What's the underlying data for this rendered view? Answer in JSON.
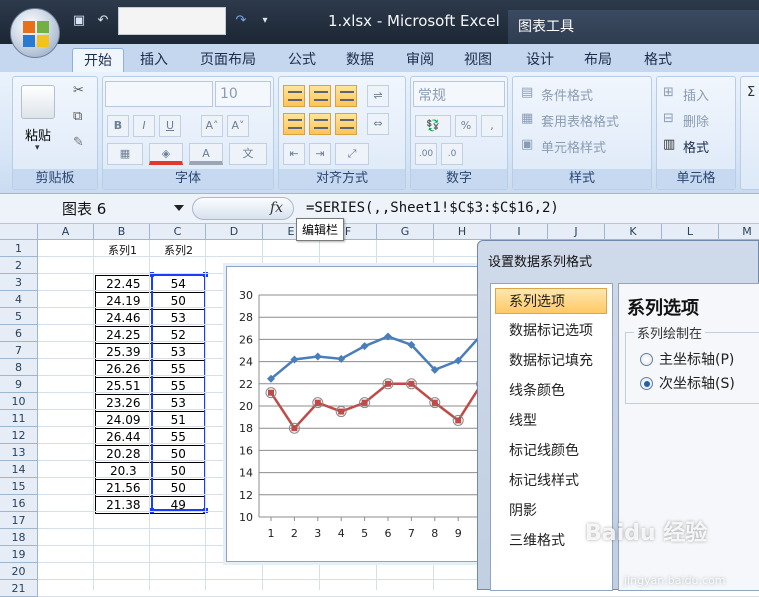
{
  "window": {
    "title": "1.xlsx - Microsoft Excel",
    "context_tab": "图表工具"
  },
  "ribbon": {
    "tabs": [
      "开始",
      "插入",
      "页面布局",
      "公式",
      "数据",
      "审阅",
      "视图",
      "设计",
      "布局",
      "格式"
    ],
    "active_tab": "开始",
    "groups": {
      "clipboard": {
        "label": "剪贴板",
        "paste": "粘贴"
      },
      "font": {
        "label": "字体",
        "size": "10",
        "bold": "B",
        "italic": "I",
        "underline": "U"
      },
      "alignment": {
        "label": "对齐方式"
      },
      "number": {
        "label": "数字",
        "format": "常规",
        "percent": "%",
        "comma": ",",
        "inc_dec": ".00",
        "dec_dec": ".0"
      },
      "styles": {
        "label": "样式",
        "conditional": "条件格式",
        "table": "套用表格格式",
        "cell_styles": "单元格样式"
      },
      "cells": {
        "label": "单元格",
        "insert": "插入",
        "delete": "删除",
        "format": "格式"
      }
    }
  },
  "formula_bar": {
    "name_box": "图表 6",
    "fx": "fx",
    "formula": "=SERIES(,,Sheet1!$C$3:$C$16,2)",
    "tooltip": "编辑栏"
  },
  "sheet": {
    "columns": [
      "A",
      "B",
      "C",
      "D",
      "E",
      "F",
      "G",
      "H",
      "I",
      "J",
      "K",
      "L",
      "M"
    ],
    "rows": [
      "1",
      "2",
      "3",
      "4",
      "5",
      "6",
      "7",
      "8",
      "9",
      "10",
      "11",
      "12",
      "13",
      "14",
      "15",
      "16",
      "17",
      "18",
      "19",
      "20",
      "21"
    ],
    "headers": {
      "b1": "系列1",
      "c1": "系列2"
    },
    "table": [
      [
        "22.45",
        "54"
      ],
      [
        "24.19",
        "50"
      ],
      [
        "24.46",
        "53"
      ],
      [
        "24.25",
        "52"
      ],
      [
        "25.39",
        "53"
      ],
      [
        "26.26",
        "55"
      ],
      [
        "25.51",
        "55"
      ],
      [
        "23.26",
        "53"
      ],
      [
        "24.09",
        "51"
      ],
      [
        "26.44",
        "55"
      ],
      [
        "20.28",
        "50"
      ],
      [
        "20.3",
        "50"
      ],
      [
        "21.56",
        "50"
      ],
      [
        "21.38",
        "49"
      ]
    ]
  },
  "chart_data": {
    "type": "line",
    "x": [
      1,
      2,
      3,
      4,
      5,
      6,
      7,
      8,
      9,
      10
    ],
    "xticks": [
      "1",
      "2",
      "3",
      "4",
      "5",
      "6",
      "7",
      "8",
      "9"
    ],
    "ylim": [
      10,
      30
    ],
    "yticks": [
      "10",
      "12",
      "14",
      "16",
      "18",
      "20",
      "22",
      "24",
      "26",
      "28",
      "30"
    ],
    "grid": true,
    "series": [
      {
        "color": "#4a7ebb",
        "marker": "diamond",
        "values": [
          22.45,
          24.19,
          24.46,
          24.25,
          25.39,
          26.26,
          25.51,
          23.26,
          24.09,
          26.44
        ]
      },
      {
        "color": "#be4b48",
        "marker": "square-selected",
        "axis": "secondary",
        "values": [
          21.2,
          18.0,
          20.3,
          19.5,
          20.3,
          22.0,
          22.0,
          20.3,
          18.7,
          22.0
        ]
      }
    ]
  },
  "dialog": {
    "title": "设置数据系列格式",
    "nav": [
      "系列选项",
      "数据标记选项",
      "数据标记填充",
      "线条颜色",
      "线型",
      "标记线颜色",
      "标记线样式",
      "阴影",
      "三维格式"
    ],
    "active_nav": "系列选项",
    "panel_title": "系列选项",
    "plot_on_label": "系列绘制在",
    "options": [
      {
        "label": "主坐标轴(P)",
        "checked": false
      },
      {
        "label": "次坐标轴(S)",
        "checked": true
      }
    ]
  },
  "watermark": {
    "text": "Baidu 经验",
    "sub": "jingyan.baidu.com"
  }
}
